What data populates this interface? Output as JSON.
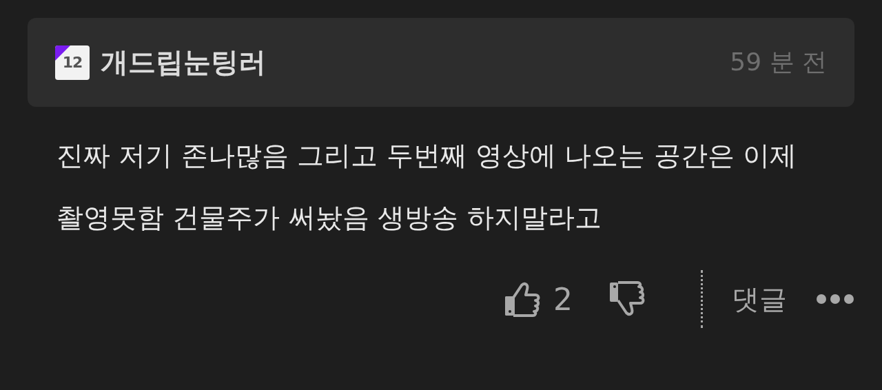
{
  "comment": {
    "author": {
      "level_badge": "12",
      "name": "개드립눈팅러"
    },
    "time": "59 분 전",
    "text": "진짜 저기 존나많음 그리고 두번째 영상에 나오는 공간은 이제 촬영못함 건물주가 써놨음 생방송 하지말라고",
    "likes": "2",
    "reply_label": "댓글"
  }
}
